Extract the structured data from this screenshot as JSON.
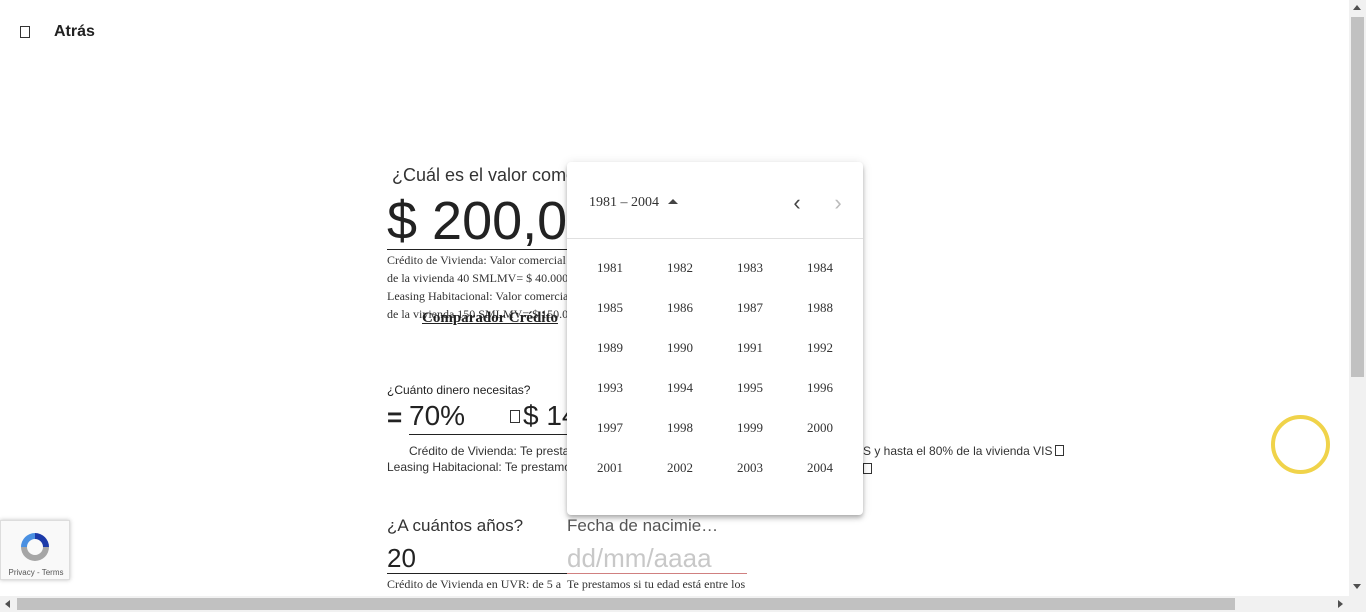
{
  "header": {
    "back_label": "Atrás"
  },
  "form": {
    "value_question": "¿Cuál es el valor come",
    "value_amount": "$ 200,0",
    "value_notes": [
      "Crédito de Vivienda: Valor comercial",
      "de la vivienda 40 SMLMV= $ 40.000",
      "Leasing Habitacional: Valor comercia",
      "de la vivienda 150 SMLMV= $ 150.0"
    ],
    "comparador_link": "Comparador Crédito",
    "money_question": "¿Cuánto dinero necesitas?",
    "equals": "=",
    "percent": "70%",
    "money_amount": "$ 14",
    "money_notes": [
      {
        "left": "Crédito de Vivienda: Te prestam",
        "right": "S y hasta el 80% de la vivienda VIS"
      },
      {
        "left": "Leasing Habitacional: Te prestamos",
        "right": ""
      }
    ],
    "years_question": "¿A cuántos años?",
    "years_value": "20",
    "years_note": "Crédito de Vivienda en UVR: de 5 a",
    "birth_question": "Fecha de nacimie…",
    "birth_placeholder": "dd/mm/aaaa",
    "birth_note": "Te prestamos si tu edad está entre los"
  },
  "year_picker": {
    "range_label": "1981 – 2004",
    "years": [
      "1981",
      "1982",
      "1983",
      "1984",
      "1985",
      "1986",
      "1987",
      "1988",
      "1989",
      "1990",
      "1991",
      "1992",
      "1993",
      "1994",
      "1995",
      "1996",
      "1997",
      "1998",
      "1999",
      "2000",
      "2001",
      "2002",
      "2003",
      "2004"
    ]
  },
  "recaptcha": {
    "privacy": "Privacy",
    "separator": " - ",
    "terms": "Terms"
  },
  "colors": {
    "ring": "#f0d34a",
    "recaptcha_blue": "#1c3aa9",
    "recaptcha_grey": "#a6a6a6"
  }
}
